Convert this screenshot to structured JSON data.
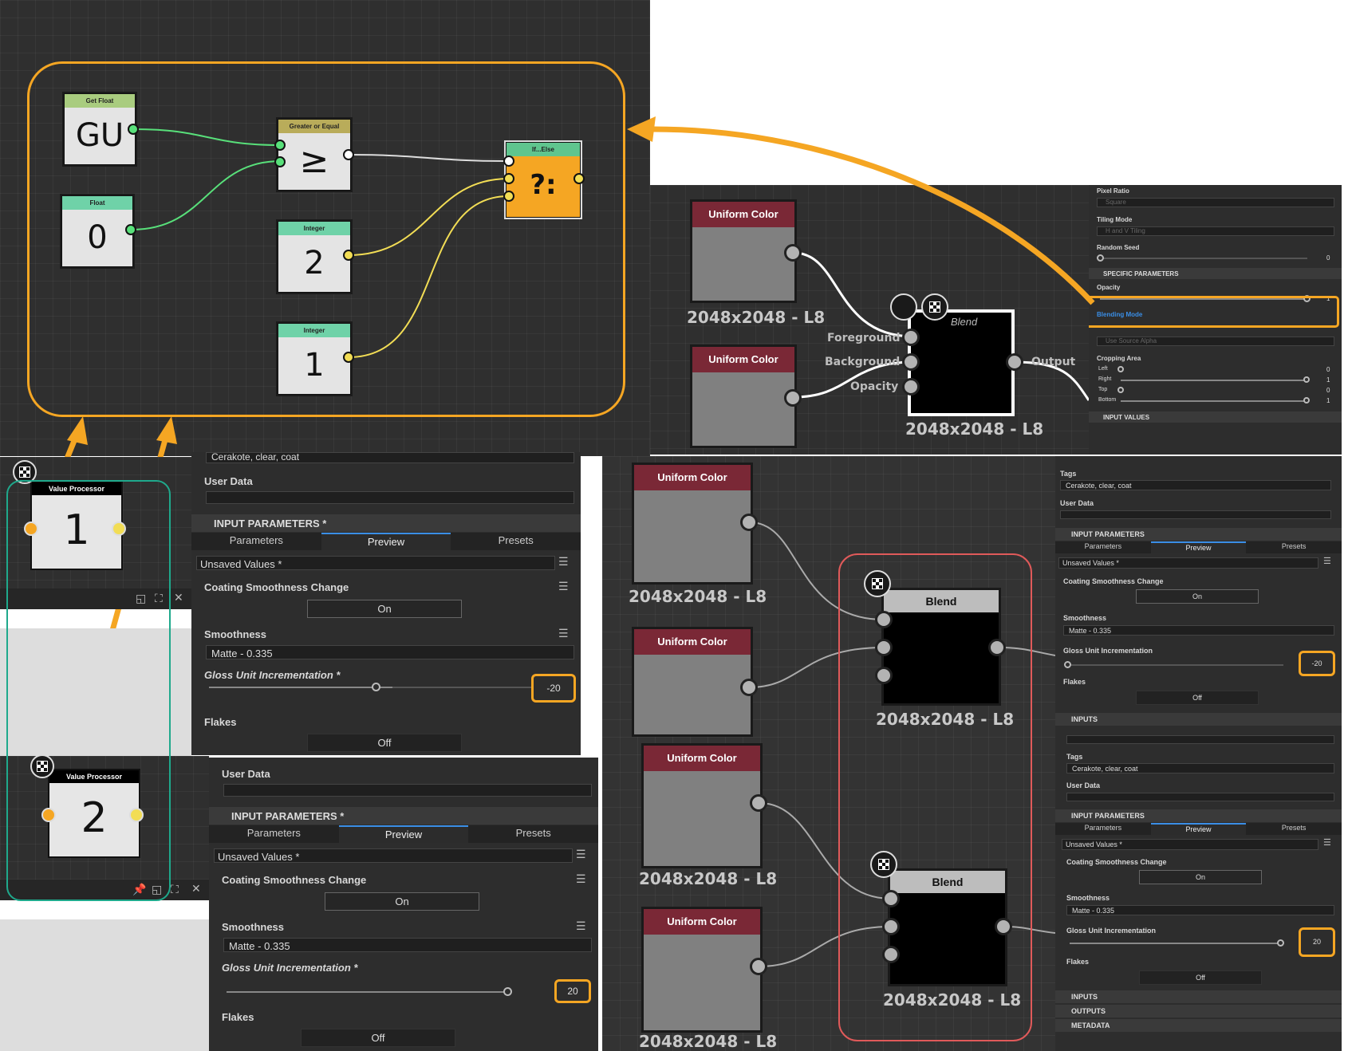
{
  "function_graph": {
    "nodes": [
      {
        "title": "Get Float",
        "value": "GU",
        "header_color": "#a9cc7f"
      },
      {
        "title": "Float",
        "value": "0",
        "header_color": "#6fd2a8"
      },
      {
        "title": "Greater or Equal",
        "value": "≥",
        "header_color": "#b9ac5a"
      },
      {
        "title": "Integer",
        "value": "2",
        "header_color": "#6fd2a8"
      },
      {
        "title": "Integer",
        "value": "1",
        "header_color": "#6fd2a8"
      },
      {
        "title": "If...Else",
        "value": "?:",
        "header_color": "#5fc58e"
      }
    ]
  },
  "top_right_graph": {
    "uniform_1": "Uniform Color",
    "uniform_2": "Uniform Color",
    "res_1": "2048x2048 - L8",
    "res_2": "2048x2048 - L8",
    "blend_res": "2048x2048 - L8",
    "blend_title": "Blend",
    "foreground": "Foreground",
    "background": "Background",
    "opacity": "Opacity",
    "output": "Output"
  },
  "top_props": {
    "pixel_ratio": "Pixel Ratio",
    "pixel_ratio_value": "Square",
    "tiling_mode": "Tiling Mode",
    "tiling_value": "H and V Tiling",
    "random_seed": "Random Seed",
    "random_seed_value": "0",
    "specific": "SPECIFIC PARAMETERS",
    "opacity": "Opacity",
    "opacity_value": "1",
    "blending_mode": "Blending Mode",
    "alpha_value": "Use Source Alpha",
    "cropping": "Cropping Area",
    "left": "Left",
    "left_v": "0",
    "right": "Right",
    "right_v": "1",
    "top": "Top",
    "top_v": "0",
    "bottom": "Bottom",
    "bottom_v": "1",
    "input_values": "INPUT VALUES"
  },
  "value_processor_1": {
    "title": "Value Processor",
    "value": "1"
  },
  "value_processor_2": {
    "title": "Value Processor",
    "value": "2"
  },
  "panel_a": {
    "tags_value": "Cerakote, clear, coat",
    "user_data": "User Data",
    "input_params": "INPUT PARAMETERS *",
    "tabs": [
      "Parameters",
      "Preview",
      "Presets"
    ],
    "preset": "Unsaved Values *",
    "coating": "Coating Smoothness Change",
    "on": "On",
    "smoothness": "Smoothness",
    "smooth_value": "Matte - 0.335",
    "gloss": "Gloss Unit Incrementation *",
    "gloss_value": "-20",
    "flakes": "Flakes",
    "off": "Off"
  },
  "panel_b": {
    "user_data": "User Data",
    "input_params": "INPUT PARAMETERS *",
    "tabs": [
      "Parameters",
      "Preview",
      "Presets"
    ],
    "preset": "Unsaved Values *",
    "coating": "Coating Smoothness Change",
    "on": "On",
    "smoothness": "Smoothness",
    "smooth_value": "Matte - 0.335",
    "gloss": "Gloss Unit Incrementation *",
    "gloss_value": "20",
    "flakes": "Flakes",
    "off": "Off"
  },
  "bottom_graph": {
    "uniform": [
      "Uniform Color",
      "Uniform Color",
      "Uniform Color",
      "Uniform Color"
    ],
    "res": [
      "2048x2048 - L8",
      "2048x2048 - L8",
      "2048x2048 - L8",
      "2048x2048 - L8"
    ],
    "blend_1": "Blend",
    "blend_2": "Blend",
    "blend_res_1": "2048x2048 - L8",
    "blend_res_2": "2048x2048 - L8"
  },
  "panel_c": {
    "tags": "Tags",
    "tags_value": "Cerakote, clear, coat",
    "user_data": "User Data",
    "input_params": "INPUT PARAMETERS",
    "tabs": [
      "Parameters",
      "Preview",
      "Presets"
    ],
    "preset": "Unsaved Values *",
    "coating": "Coating Smoothness Change",
    "on": "On",
    "smoothness": "Smoothness",
    "smooth_value": "Matte - 0.335",
    "gloss": "Gloss Unit Incrementation",
    "gloss_value": "-20",
    "flakes": "Flakes",
    "off": "Off",
    "inputs": "INPUTS"
  },
  "panel_d": {
    "tags": "Tags",
    "tags_value": "Cerakote, clear, coat",
    "user_data": "User Data",
    "input_params": "INPUT PARAMETERS",
    "tabs": [
      "Parameters",
      "Preview",
      "Presets"
    ],
    "preset": "Unsaved Values *",
    "coating": "Coating Smoothness Change",
    "on": "On",
    "smoothness": "Smoothness",
    "smooth_value": "Matte - 0.335",
    "gloss": "Gloss Unit Incrementation",
    "gloss_value": "20",
    "flakes": "Flakes",
    "off": "Off",
    "inputs": "INPUTS",
    "outputs": "OUTPUTS",
    "metadata": "METADATA"
  },
  "colors": {
    "highlight": "#f5a623",
    "teal": "#1fa98c",
    "red": "#e05a5a",
    "accent_blue": "#3a8ee6"
  }
}
